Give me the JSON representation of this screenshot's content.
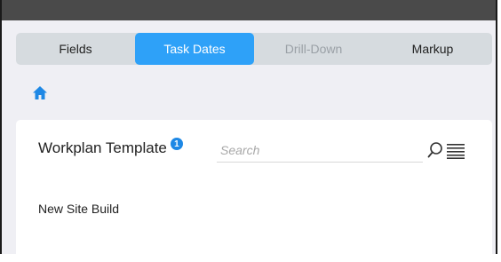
{
  "tabs": [
    {
      "label": "Fields"
    },
    {
      "label": "Task Dates"
    },
    {
      "label": "Drill-Down"
    },
    {
      "label": "Markup"
    }
  ],
  "active_tab": "Task Dates",
  "home_icon": "home-icon",
  "panel": {
    "title": "Workplan Template",
    "badge": "1",
    "search_placeholder": "Search",
    "items": [
      {
        "label": "New Site Build"
      }
    ]
  },
  "colors": {
    "accent": "#2ea1f8",
    "badge": "#1e88e5",
    "top_bar": "#4a4a4a",
    "tab_bar": "#d6dbdf",
    "background": "#efeff4"
  }
}
